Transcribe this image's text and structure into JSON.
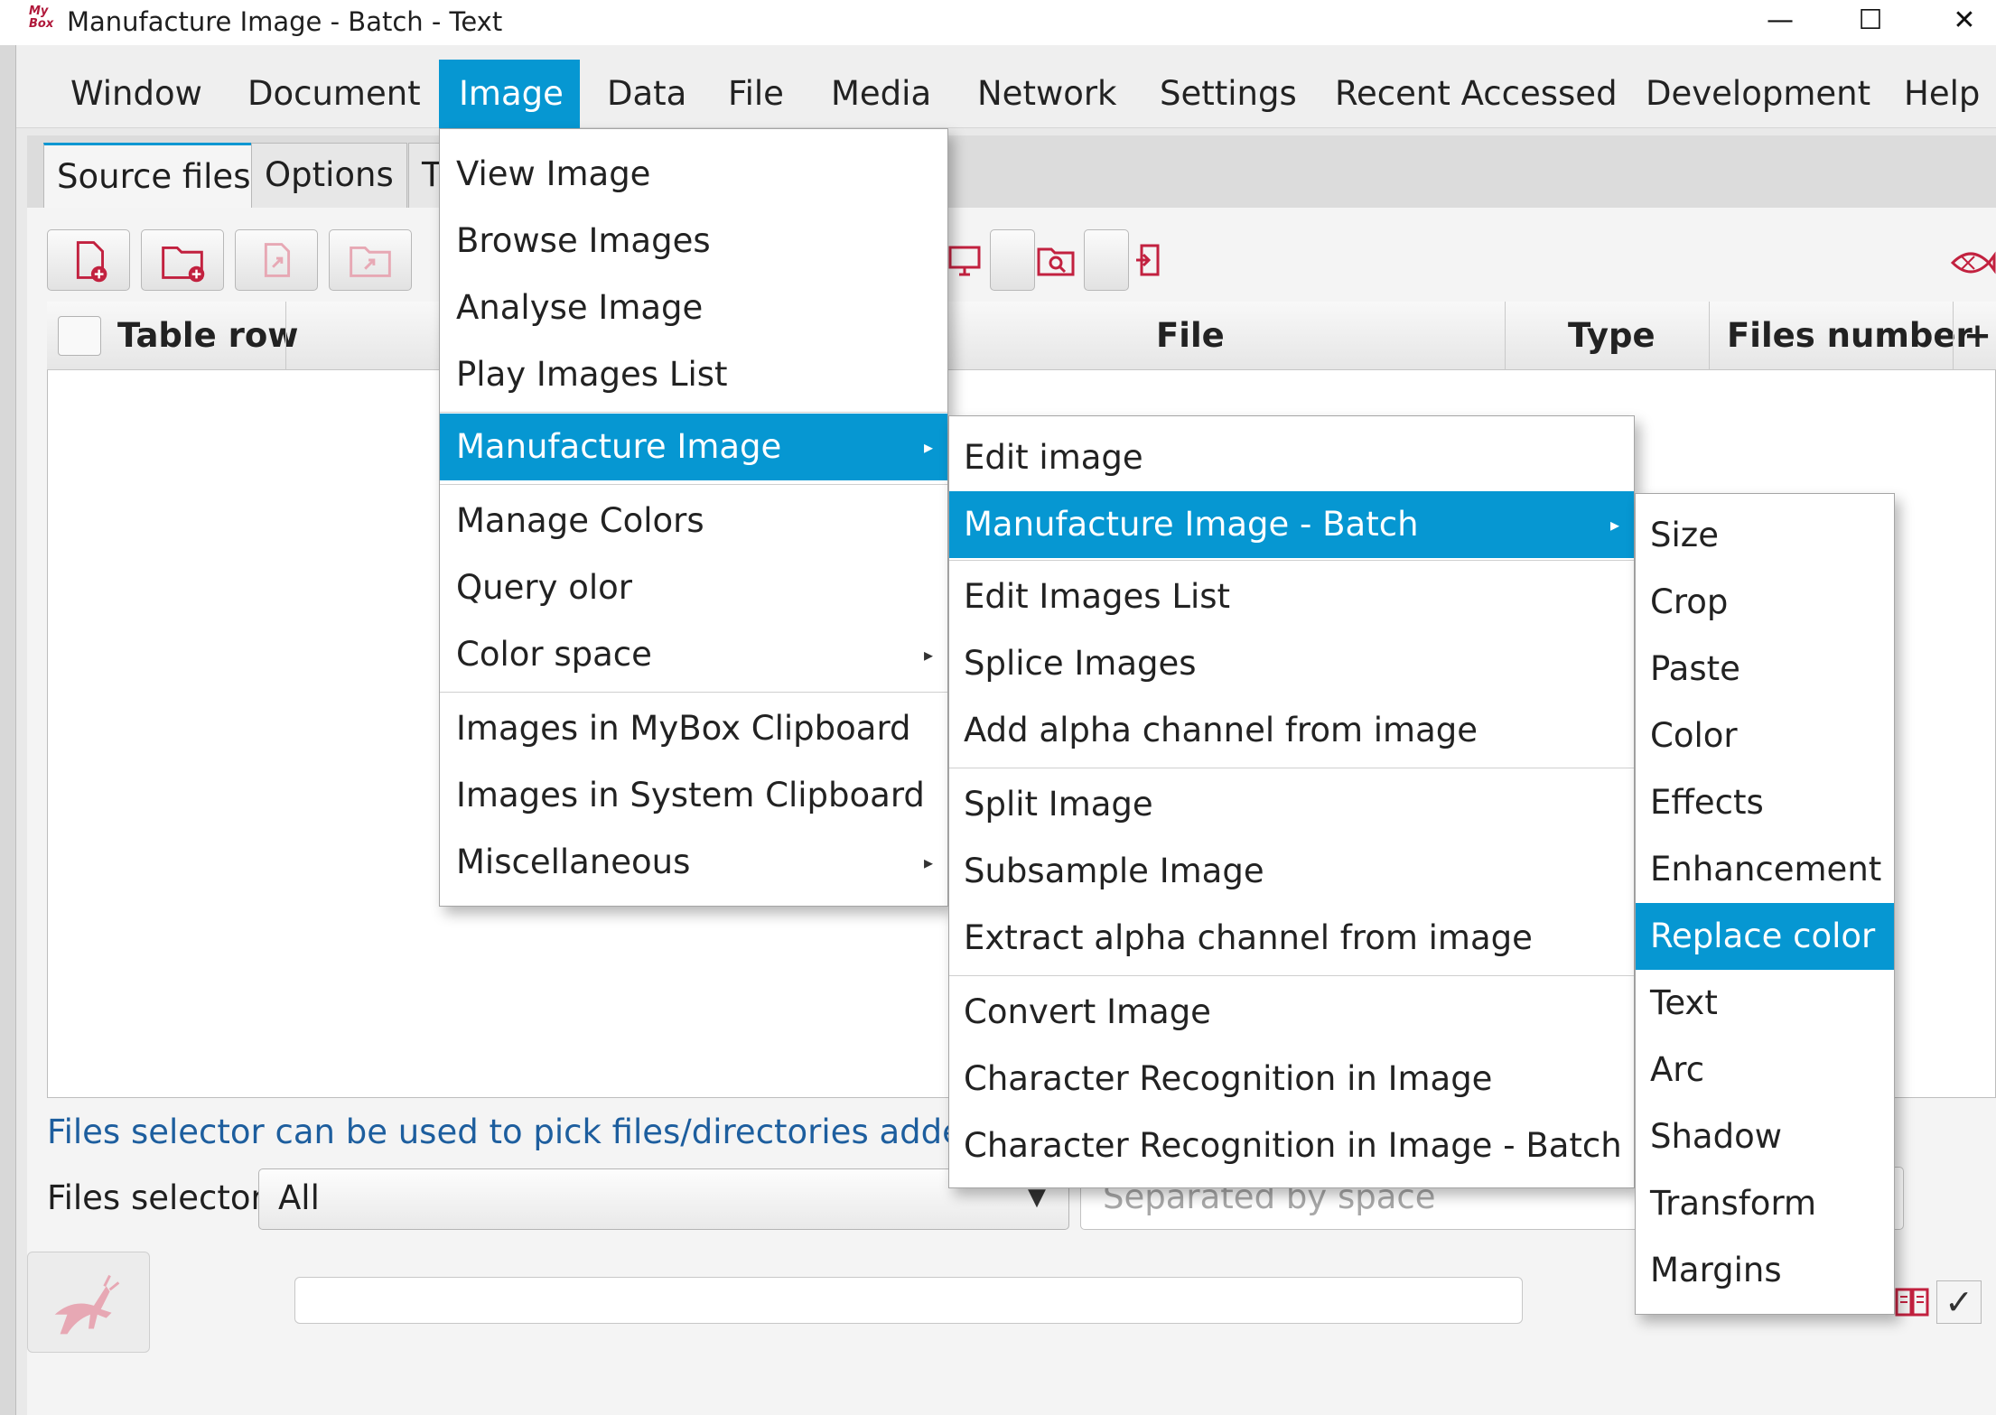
{
  "window": {
    "app_logo": "My Box",
    "title": "Manufacture Image - Batch - Text",
    "minimize": "—",
    "maximize": "☐",
    "close": "✕"
  },
  "menubar": {
    "items": [
      "Window",
      "Document",
      "Image",
      "Data",
      "File",
      "Media",
      "Network",
      "Settings",
      "Recent Accessed",
      "Development",
      "Help"
    ],
    "active": "Image"
  },
  "tabs": [
    "Source files",
    "Options",
    "T"
  ],
  "table": {
    "columns": [
      "Table row",
      "File",
      "Type",
      "Files number",
      "+"
    ]
  },
  "hint": "Files selector can be used to pick files/directories added in",
  "selector": {
    "label": "Files selector",
    "value": "All",
    "placeholder": "Separated by space"
  },
  "image_menu": {
    "items": [
      "View Image",
      "Browse Images",
      "Analyse Image",
      "Play Images List",
      "Manufacture Image",
      "Manage Colors",
      "Query olor",
      "Color space",
      "Images in MyBox Clipboard",
      "Images in System Clipboard",
      "Miscellaneous"
    ],
    "highlighted": "Manufacture Image"
  },
  "manufacture_menu": {
    "items": [
      "Edit image",
      "Manufacture Image - Batch",
      "Edit Images List",
      "Splice Images",
      "Add alpha channel from image",
      "Split Image",
      "Subsample Image",
      "Extract alpha channel from image",
      "Convert Image",
      "Character Recognition in Image",
      "Character Recognition in Image - Batch"
    ],
    "highlighted": "Manufacture Image - Batch"
  },
  "batch_menu": {
    "items": [
      "Size",
      "Crop",
      "Paste",
      "Color",
      "Effects",
      "Enhancement",
      "Replace color",
      "Text",
      "Arc",
      "Shadow",
      "Transform",
      "Margins"
    ],
    "highlighted": "Replace color"
  },
  "icons": {
    "add_file": "add-file-icon",
    "add_folder": "add-folder-icon",
    "submenu_arrow": "▸",
    "combo_arrow": "▼",
    "check": "✓"
  },
  "colors": {
    "accent": "#0697d2",
    "icon_red": "#c2213f",
    "hint_blue": "#1d5e9e"
  }
}
